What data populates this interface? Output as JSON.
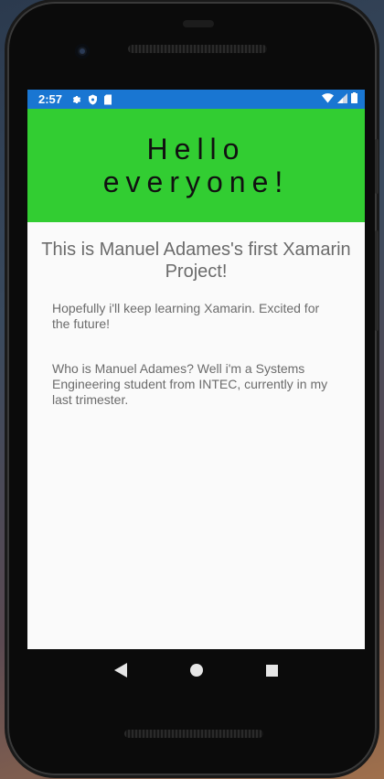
{
  "status_bar": {
    "time": "2:57",
    "left_icons": [
      "gear-icon",
      "shield-icon",
      "sd-card-icon"
    ],
    "right_icons": [
      "wifi-icon",
      "cell-signal-icon",
      "battery-icon"
    ],
    "color": "#1976d2"
  },
  "header": {
    "title": "Hello everyone!",
    "background": "#32cd32"
  },
  "content": {
    "subtitle": "This is Manuel Adames's first Xamarin Project!",
    "paragraph1": "Hopefully i'll keep learning Xamarin. Excited for the future!",
    "paragraph2": "Who is Manuel Adames? Well i'm a Systems Engineering student from INTEC, currently in my last trimester."
  },
  "nav_bar": {
    "buttons": [
      "back-icon",
      "home-icon",
      "recents-icon"
    ]
  }
}
